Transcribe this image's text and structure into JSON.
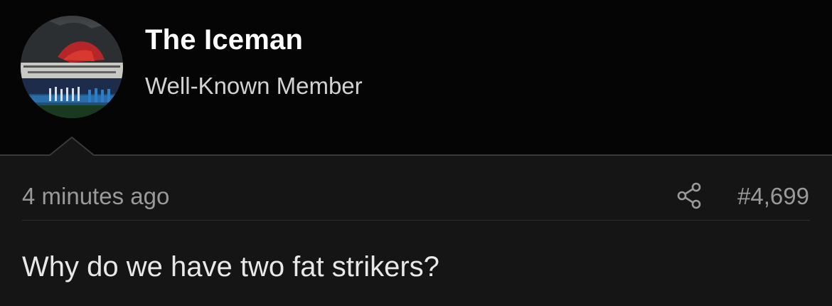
{
  "user": {
    "name": "The Iceman",
    "title": "Well-Known Member",
    "avatar_icon": "avatar-image"
  },
  "post": {
    "timestamp": "4 minutes ago",
    "number": "#4,699",
    "share_icon": "share-icon",
    "message": "Why do we have two fat strikers?"
  },
  "colors": {
    "header_bg": "#050505",
    "body_bg": "#151515",
    "username": "#ffffff",
    "muted_text": "#9a9a9a",
    "message_text": "#e8e8e8"
  }
}
